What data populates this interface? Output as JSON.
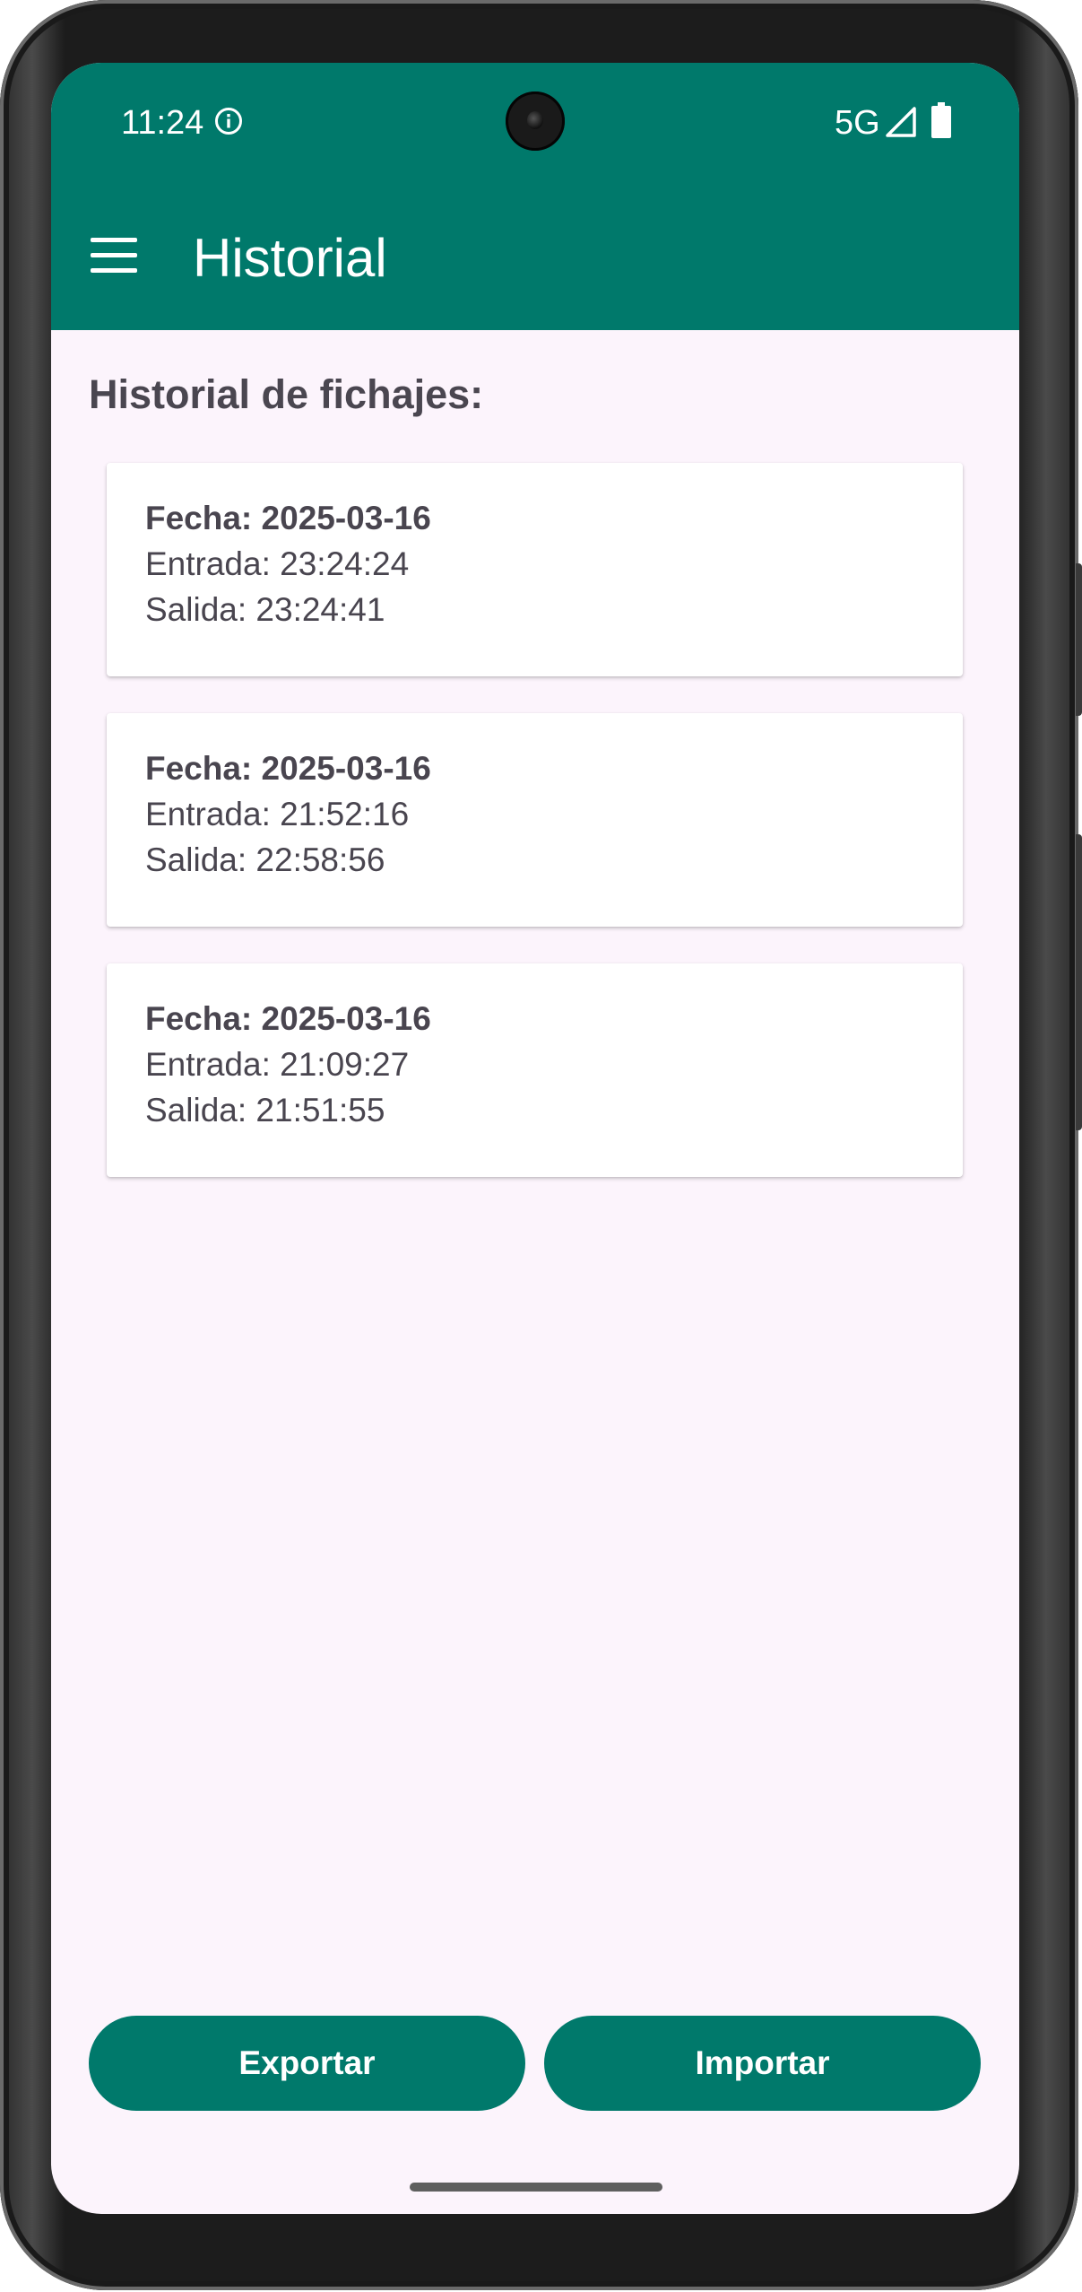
{
  "status_bar": {
    "time": "11:24",
    "network": "5G",
    "icons": [
      "info-icon",
      "signal-icon",
      "battery-icon"
    ]
  },
  "app_bar": {
    "menu_icon": "menu-icon",
    "title": "Historial"
  },
  "section": {
    "title": "Historial de fichajes:"
  },
  "records": [
    {
      "fecha": "Fecha: 2025-03-16",
      "entrada": "Entrada: 23:24:24",
      "salida": "Salida: 23:24:41"
    },
    {
      "fecha": "Fecha: 2025-03-16",
      "entrada": "Entrada: 21:52:16",
      "salida": "Salida: 22:58:56"
    },
    {
      "fecha": "Fecha: 2025-03-16",
      "entrada": "Entrada: 21:09:27",
      "salida": "Salida: 21:51:55"
    }
  ],
  "actions": {
    "export_label": "Exportar",
    "import_label": "Importar"
  },
  "colors": {
    "primary": "#00796b",
    "background": "#fcf4fc",
    "card": "#ffffff",
    "text": "#49454f"
  }
}
